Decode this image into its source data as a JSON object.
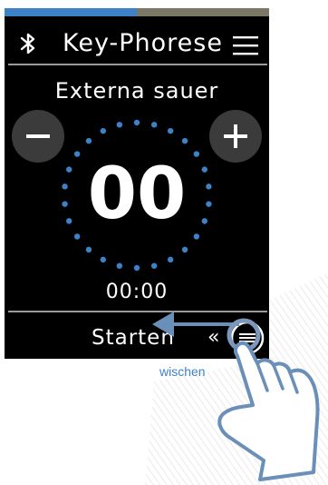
{
  "progress": {
    "fraction": 0.5
  },
  "header": {
    "bluetooth_icon": "bluetooth-icon",
    "title": "Key-Phorese",
    "menu_icon": "hamburger-menu-icon"
  },
  "program": {
    "name": "Externa sauer"
  },
  "controls": {
    "minus_icon": "minus-icon",
    "plus_icon": "plus-icon"
  },
  "counter": {
    "value": "00"
  },
  "timer": {
    "value": "00:00"
  },
  "footer": {
    "start_label": "Starten",
    "chevron": "«",
    "swipe_icon": "swipe-handle-icon"
  },
  "gesture_hint": {
    "label": "wischen",
    "color": "#3d82c6",
    "icon": "hand-swipe-icon"
  },
  "colors": {
    "background": "#000000",
    "accent": "#3d82c6",
    "progress_track": "#7c7868",
    "button_bg": "#3b3b3b",
    "text": "#ffffff"
  }
}
